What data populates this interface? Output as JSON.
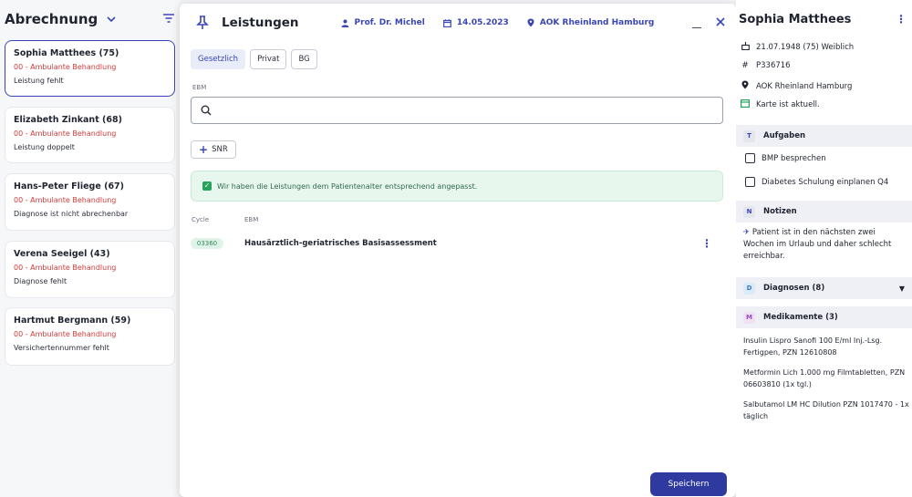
{
  "left": {
    "title": "Abrechnung",
    "patients": [
      {
        "name": "Sophia Matthees  (75)",
        "code": "00 - Ambulante Behandlung",
        "note": "Leistung fehlt"
      },
      {
        "name": "Elizabeth Zinkant  (68)",
        "code": "00 - Ambulante Behandlung",
        "note": "Leistung doppelt"
      },
      {
        "name": "Hans-Peter Fliege  (67)",
        "code": "00 - Ambulante Behandlung",
        "note": "Diagnose ist nicht abrechenbar"
      },
      {
        "name": "Verena Seeigel  (43)",
        "code": "00 - Ambulante Behandlung",
        "note": "Diagnose fehlt"
      },
      {
        "name": "Hartmut Bergmann  (59)",
        "code": "00 - Ambulante Behandlung",
        "note": "Versichertennummer fehlt"
      }
    ]
  },
  "modal": {
    "title": "Leistungen",
    "doctor": "Prof. Dr. Michel",
    "date": "14.05.2023",
    "insurance": "AOK Rheinland Hamburg",
    "tabs": [
      "Gesetzlich",
      "Privat",
      "BG"
    ],
    "ebm_label": "EBM",
    "search_placeholder": "",
    "snr_label": "SNR",
    "alert": "Wir haben die Leistungen dem Patientenalter entsprechend angepasst.",
    "col_cycle": "Cycle",
    "col_ebm": "EBM",
    "rows": [
      {
        "code": "03360",
        "desc": "Hausärztlich-geriatrisches Basisassessment"
      }
    ],
    "save_label": "Speichern"
  },
  "right": {
    "name": "Sophia Matthees",
    "dob": "21.07.1948 (75) Weiblich",
    "id": "P336716",
    "insurance": "AOK Rheinland Hamburg",
    "card": "Karte ist aktuell.",
    "tasks_title": "Aufgaben",
    "tasks_badge": "T",
    "tasks": [
      "BMP besprechen",
      "Diabetes Schulung einplanen Q4"
    ],
    "notes_title": "Notizen",
    "notes_badge": "N",
    "note_text": "Patient ist in den nächsten zwei Wochen im Urlaub und daher schlecht erreichbar.",
    "diag_title": "Diagnosen (8)",
    "diag_badge": "D",
    "meds_title": "Medikamente (3)",
    "meds_badge": "M",
    "meds": [
      "Insulin Lispro Sanofi 100 E/ml Inj.-Lsg. Fertigpen, PZN 12610808",
      "Metformin Lich 1.000 mg Filmtabletten, PZN 06603810 (1x tgl.)",
      "Salbutamol LM HC Dilution PZN 1017470 - 1x täglich"
    ],
    "colors": {
      "accent": "#3a46b8",
      "danger": "#d23b3b",
      "success": "#27a25a"
    }
  }
}
